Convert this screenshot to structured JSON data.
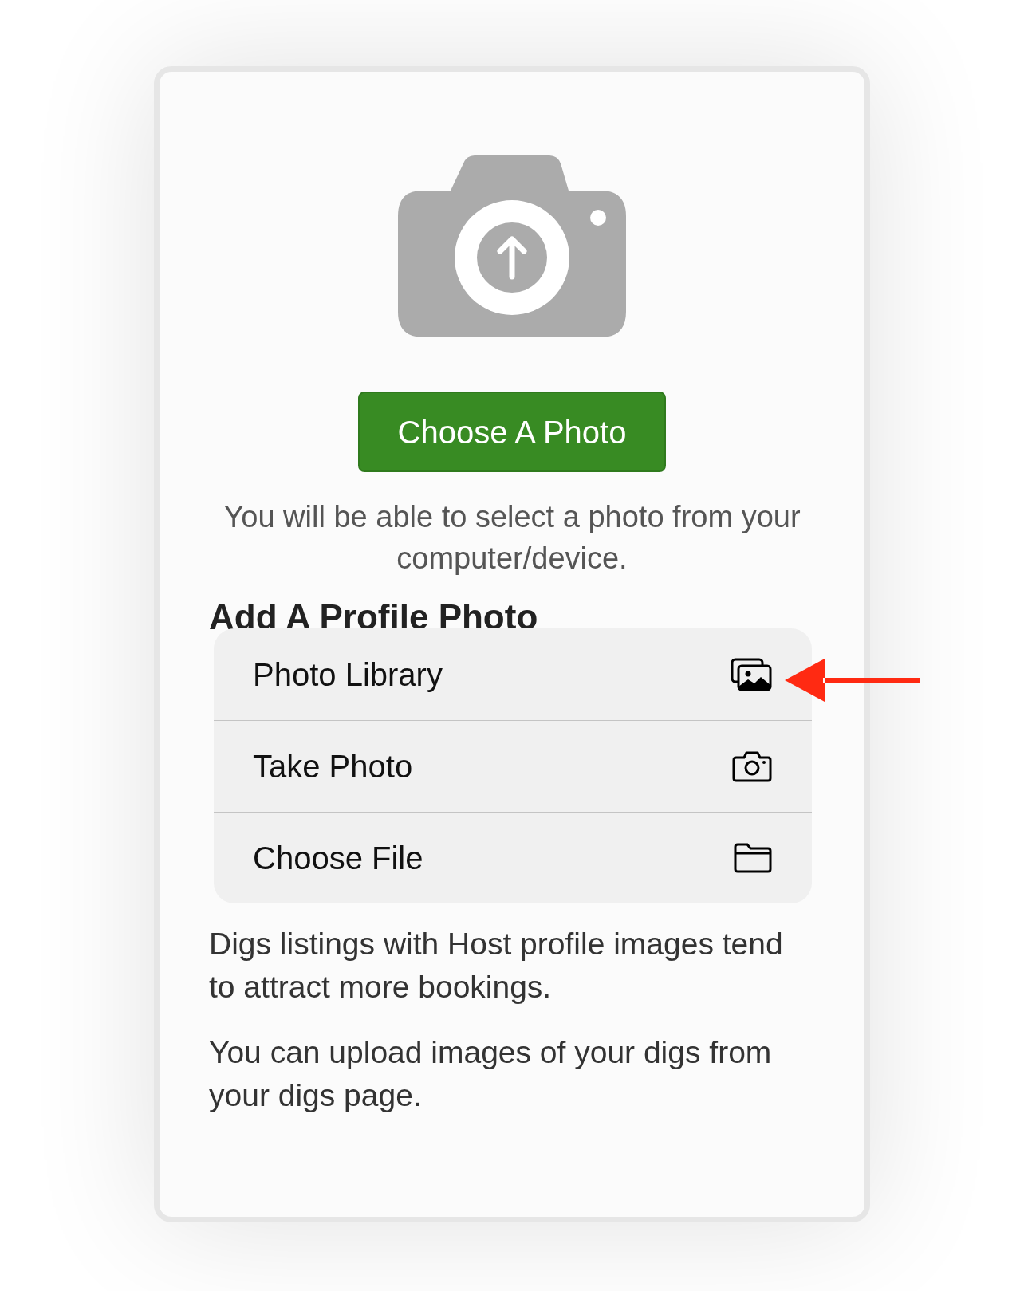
{
  "upload": {
    "button": "Choose A Photo",
    "hint": "You will be able to select a photo from your computer/device."
  },
  "heading": "Add A Profile Photo",
  "menu": [
    {
      "label": "Photo Library",
      "kind": "library"
    },
    {
      "label": "Take Photo",
      "kind": "camera"
    },
    {
      "label": "Choose File",
      "kind": "folder"
    }
  ],
  "paragraphs": [
    "Digs listings with Host profile images tend to attract more bookings.",
    "You can upload images of your digs from your digs page."
  ]
}
